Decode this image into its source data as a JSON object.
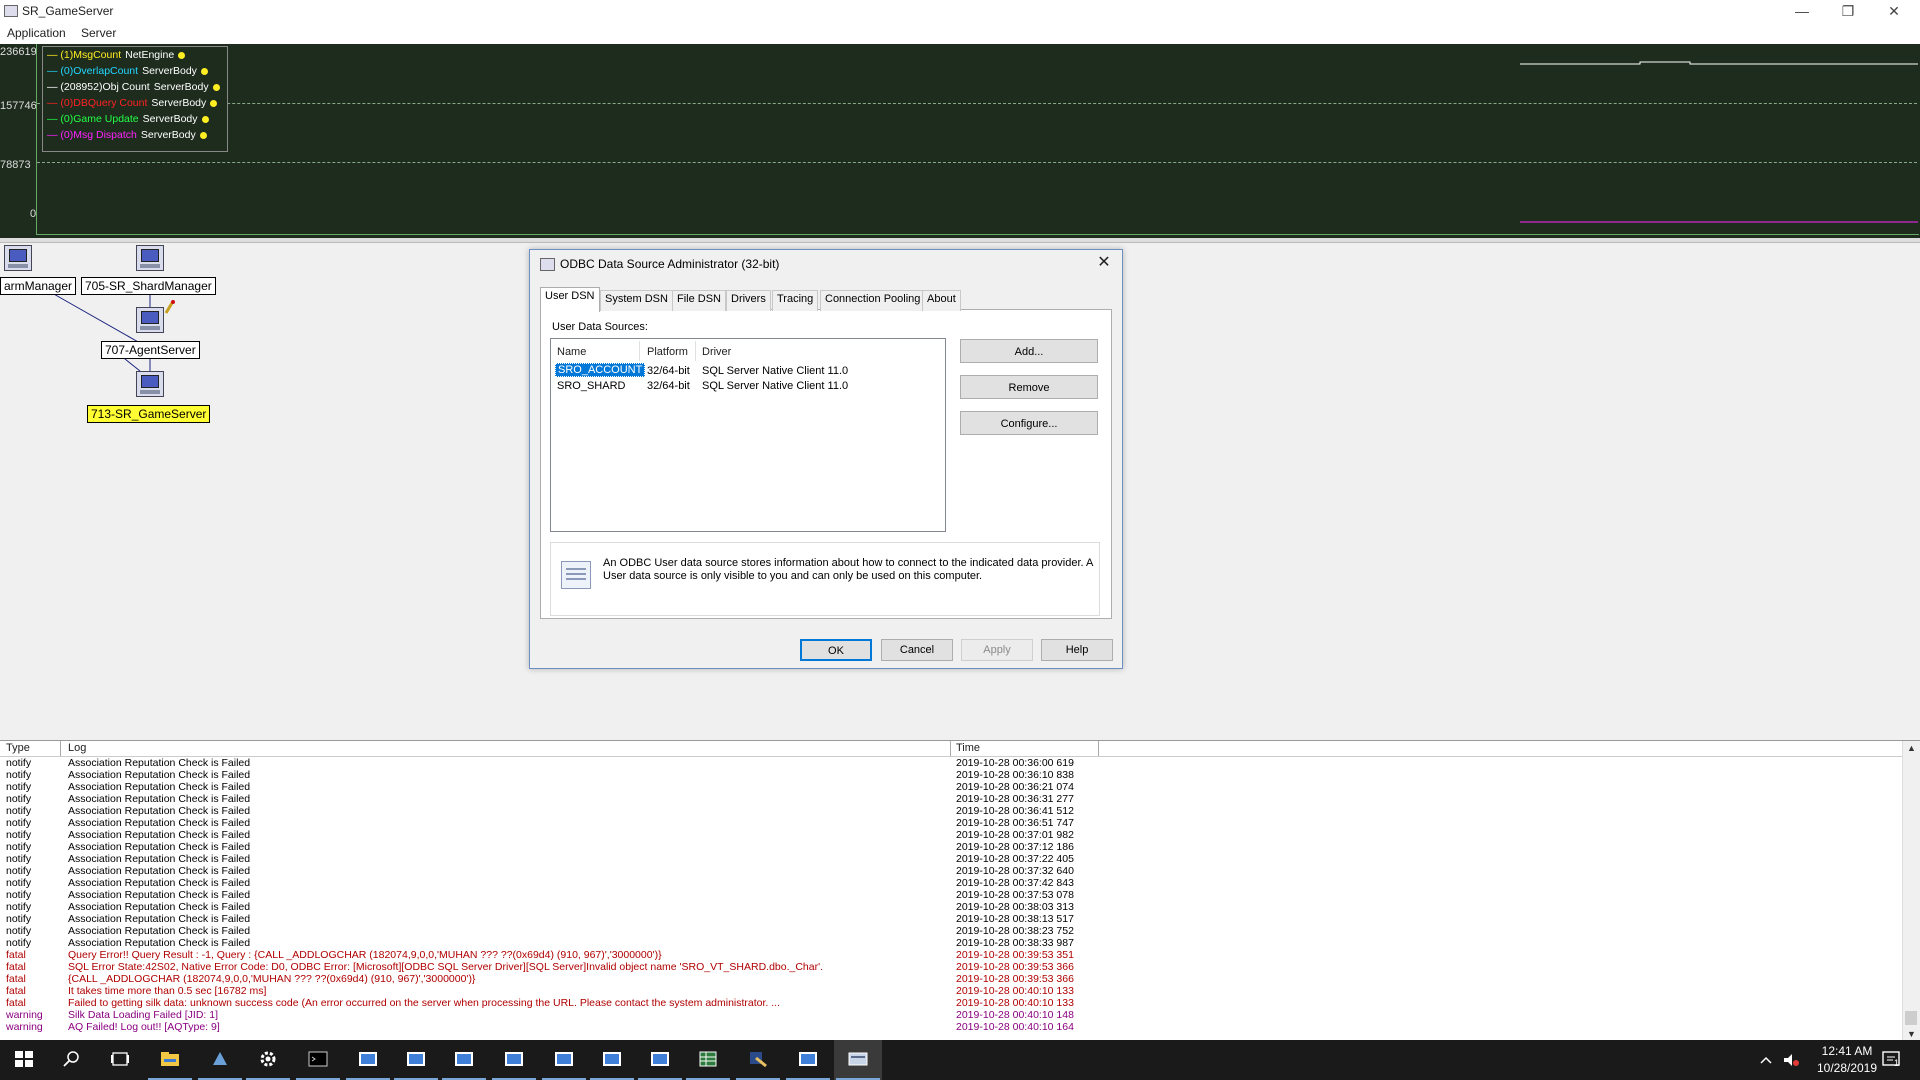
{
  "window": {
    "title": "SR_GameServer",
    "minimize": "—",
    "restore": "❐",
    "close": "✕"
  },
  "menu": [
    "Application",
    "Server"
  ],
  "graph": {
    "y_labels": [
      "236619",
      "157746",
      "78873",
      "0"
    ],
    "legend": [
      {
        "value": "(1)",
        "name": "MsgCount",
        "component": "NetEngine",
        "color": "#ffee22"
      },
      {
        "value": "(0)",
        "name": "OverlapCount",
        "component": "ServerBody",
        "color": "#22d7ff"
      },
      {
        "value": "(208952)",
        "name": "Obj Count",
        "component": "ServerBody",
        "color": "#ffffff"
      },
      {
        "value": "(0)",
        "name": "DBQuery Count",
        "component": "ServerBody",
        "color": "#ff2222"
      },
      {
        "value": "(0)",
        "name": "Game Update",
        "component": "ServerBody",
        "color": "#22ff44"
      },
      {
        "value": "(0)",
        "name": "Msg Dispatch",
        "component": "ServerBody",
        "color": "#ff22ff"
      }
    ]
  },
  "topology": {
    "nodes": [
      {
        "label": "armManager",
        "highlight": false
      },
      {
        "label": "705-SR_ShardManager",
        "highlight": false
      },
      {
        "label": "707-AgentServer",
        "highlight": false
      },
      {
        "label": "713-SR_GameServer",
        "highlight": true
      }
    ]
  },
  "dialog": {
    "title": "ODBC Data Source Administrator (32-bit)",
    "close": "✕",
    "tabs": [
      "User DSN",
      "System DSN",
      "File DSN",
      "Drivers",
      "Tracing",
      "Connection Pooling",
      "About"
    ],
    "section_label": "User Data Sources:",
    "columns": [
      "Name",
      "Platform",
      "Driver"
    ],
    "rows": [
      {
        "name": "SRO_ACCOUNT",
        "platform": "32/64-bit",
        "driver": "SQL Server Native Client 11.0",
        "selected": true
      },
      {
        "name": "SRO_SHARD",
        "platform": "32/64-bit",
        "driver": "SQL Server Native Client 11.0",
        "selected": false
      }
    ],
    "side_buttons": [
      "Add...",
      "Remove",
      "Configure..."
    ],
    "info_text": "An ODBC User data source stores information about how to connect to the indicated data provider.   A User data source is only visible to you and can only be used on this computer.",
    "bottom_buttons": [
      "OK",
      "Cancel",
      "Apply",
      "Help"
    ]
  },
  "log": {
    "columns": [
      "Type",
      "Log",
      "Time"
    ],
    "scroll_up": "▲",
    "scroll_down": "▼",
    "rows": [
      {
        "type": "notify",
        "msg": "Association Reputation Check is Failed",
        "time": "2019-10-28 00:36:00 619"
      },
      {
        "type": "notify",
        "msg": "Association Reputation Check is Failed",
        "time": "2019-10-28 00:36:10 838"
      },
      {
        "type": "notify",
        "msg": "Association Reputation Check is Failed",
        "time": "2019-10-28 00:36:21 074"
      },
      {
        "type": "notify",
        "msg": "Association Reputation Check is Failed",
        "time": "2019-10-28 00:36:31 277"
      },
      {
        "type": "notify",
        "msg": "Association Reputation Check is Failed",
        "time": "2019-10-28 00:36:41 512"
      },
      {
        "type": "notify",
        "msg": "Association Reputation Check is Failed",
        "time": "2019-10-28 00:36:51 747"
      },
      {
        "type": "notify",
        "msg": "Association Reputation Check is Failed",
        "time": "2019-10-28 00:37:01 982"
      },
      {
        "type": "notify",
        "msg": "Association Reputation Check is Failed",
        "time": "2019-10-28 00:37:12 186"
      },
      {
        "type": "notify",
        "msg": "Association Reputation Check is Failed",
        "time": "2019-10-28 00:37:22 405"
      },
      {
        "type": "notify",
        "msg": "Association Reputation Check is Failed",
        "time": "2019-10-28 00:37:32 640"
      },
      {
        "type": "notify",
        "msg": "Association Reputation Check is Failed",
        "time": "2019-10-28 00:37:42 843"
      },
      {
        "type": "notify",
        "msg": "Association Reputation Check is Failed",
        "time": "2019-10-28 00:37:53 078"
      },
      {
        "type": "notify",
        "msg": "Association Reputation Check is Failed",
        "time": "2019-10-28 00:38:03 313"
      },
      {
        "type": "notify",
        "msg": "Association Reputation Check is Failed",
        "time": "2019-10-28 00:38:13 517"
      },
      {
        "type": "notify",
        "msg": "Association Reputation Check is Failed",
        "time": "2019-10-28 00:38:23 752"
      },
      {
        "type": "notify",
        "msg": "Association Reputation Check is Failed",
        "time": "2019-10-28 00:38:33 987"
      },
      {
        "type": "fatal",
        "msg": "Query Error!! Query Result : -1, Query : {CALL _ADDLOGCHAR (182074,9,0,0,'MUHAN ??? ??(0x69d4) (910, 967)','3000000')}",
        "time": "2019-10-28 00:39:53 351"
      },
      {
        "type": "fatal",
        "msg": "SQL Error State:42S02, Native Error Code: D0, ODBC Error: [Microsoft][ODBC SQL Server Driver][SQL Server]Invalid object name 'SRO_VT_SHARD.dbo._Char'.",
        "time": "2019-10-28 00:39:53 366"
      },
      {
        "type": "fatal",
        "msg": "{CALL _ADDLOGCHAR (182074,9,0,0,'MUHAN ??? ??(0x69d4) (910, 967)','3000000')}",
        "time": "2019-10-28 00:39:53 366"
      },
      {
        "type": "fatal",
        "msg": "It takes time more than 0.5 sec [16782 ms]",
        "time": "2019-10-28 00:40:10 133"
      },
      {
        "type": "fatal",
        "msg": "Failed to getting silk data: unknown success code (An error occurred on the server when processing the URL. Please contact the system administrator. ...",
        "time": "2019-10-28 00:40:10 133"
      },
      {
        "type": "warning",
        "msg": "Silk Data Loading Failed [JID: 1]",
        "time": "2019-10-28 00:40:10 148"
      },
      {
        "type": "warning",
        "msg": "AQ Failed! Log out!! [AQType: 9]",
        "time": "2019-10-28 00:40:10 164"
      }
    ]
  },
  "log_colors": {
    "notify": "#000000",
    "fatal": "#b00000",
    "warning": "#8a0080"
  },
  "taskbar": {
    "icons": [
      {
        "name": "windows-start-icon",
        "color": "#ffffff"
      },
      {
        "name": "search-icon",
        "color": "#ffffff"
      },
      {
        "name": "task-view-icon",
        "color": "#ffffff"
      },
      {
        "name": "file-explorer-icon",
        "color": "#f2c744"
      },
      {
        "name": "app-icon",
        "color": "#6aa0d8"
      },
      {
        "name": "settings-gear-icon",
        "color": "#ffffff"
      },
      {
        "name": "command-prompt-icon",
        "color": "#cccccc"
      },
      {
        "name": "server-window-icon",
        "color": "#3f7fd8"
      },
      {
        "name": "server-window-icon",
        "color": "#3f7fd8"
      },
      {
        "name": "server-window-icon",
        "color": "#3f7fd8"
      },
      {
        "name": "server-window-icon",
        "color": "#3f7fd8"
      },
      {
        "name": "server-window-icon",
        "color": "#3f7fd8"
      },
      {
        "name": "server-window-icon",
        "color": "#3f7fd8"
      },
      {
        "name": "server-window-icon",
        "color": "#3f7fd8"
      },
      {
        "name": "spreadsheet-icon",
        "color": "#ffffff"
      },
      {
        "name": "tools-icon",
        "color": "#e8c060"
      },
      {
        "name": "server-window-icon",
        "color": "#3f7fd8"
      },
      {
        "name": "odbc-admin-icon",
        "color": "#c8d4e8"
      }
    ],
    "clock_time": "12:41 AM",
    "clock_date": "10/28/2019",
    "notification_badge": "1"
  }
}
